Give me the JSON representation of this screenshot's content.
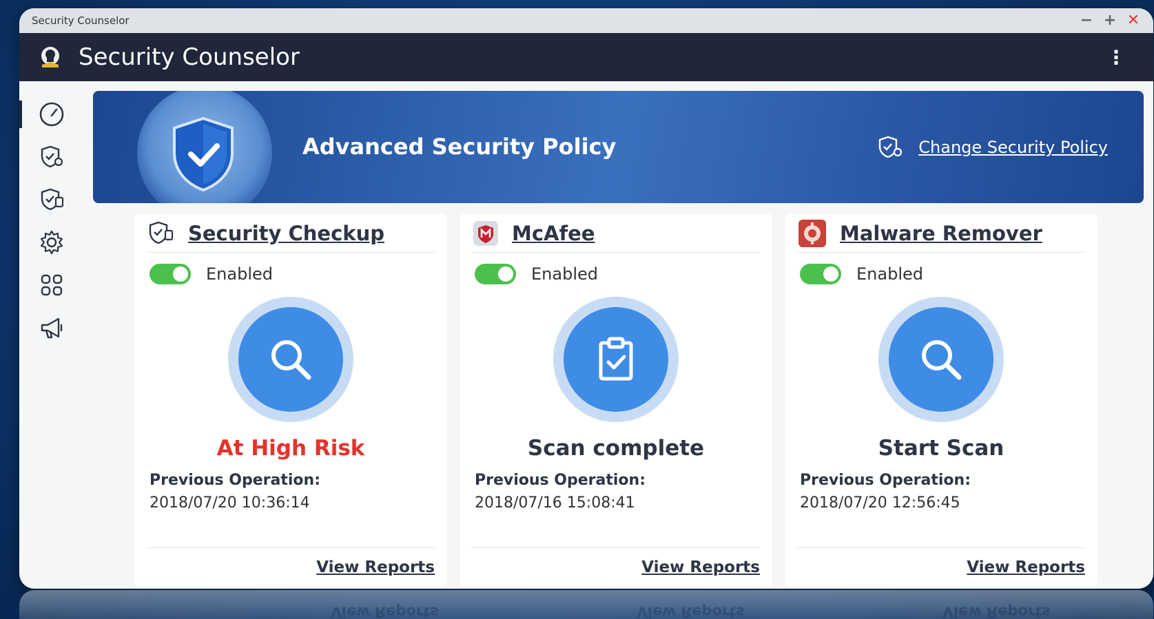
{
  "window": {
    "title": "Security Counselor"
  },
  "header": {
    "app_title": "Security Counselor"
  },
  "banner": {
    "policy_label": "Advanced Security Policy",
    "change_label": "Change Security Policy"
  },
  "cards": [
    {
      "title": "Security Checkup",
      "toggle_label": "Enabled",
      "enabled": true,
      "status": "At High Risk",
      "prev_label": "Previous Operation:",
      "prev_time": "2018/07/20 10:36:14",
      "footer_link": "View Reports",
      "icon": "magnifier-icon"
    },
    {
      "title": "McAfee",
      "toggle_label": "Enabled",
      "enabled": true,
      "status": "Scan complete",
      "prev_label": "Previous Operation:",
      "prev_time": "2018/07/16 15:08:41",
      "footer_link": "View Reports",
      "icon": "clipboard-check-icon"
    },
    {
      "title": "Malware Remover",
      "toggle_label": "Enabled",
      "enabled": true,
      "status": "Start Scan",
      "prev_label": "Previous Operation:",
      "prev_time": "2018/07/20 12:56:45",
      "footer_link": "View Reports",
      "icon": "magnifier-icon"
    }
  ],
  "colors": {
    "accent": "#3e8ce6",
    "risk": "#e5332a",
    "toggle_on": "#4cc04c",
    "header_bg": "#20273a",
    "banner_bg": "#2b58a6"
  }
}
